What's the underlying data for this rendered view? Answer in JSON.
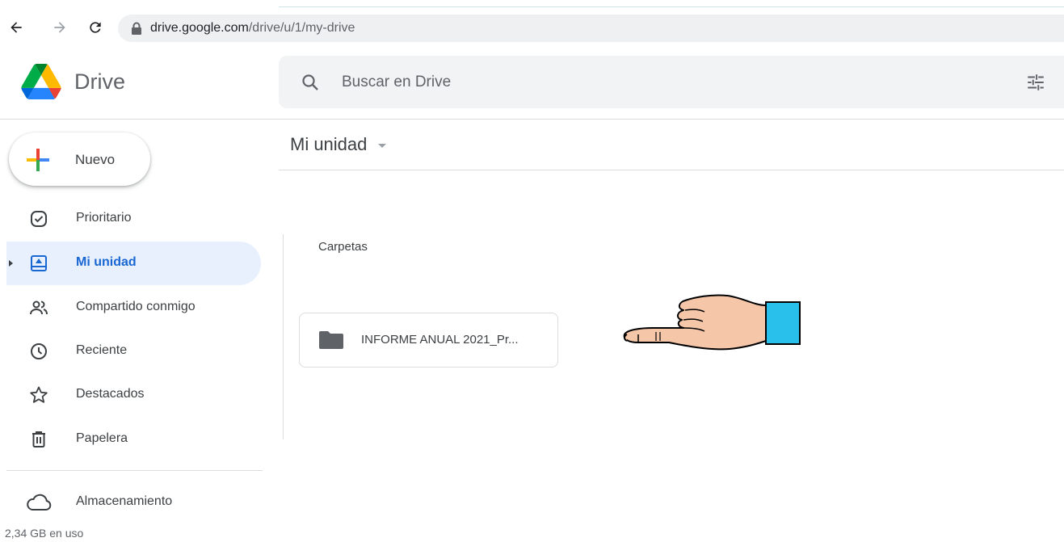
{
  "browser": {
    "url_host": "drive.google.com",
    "url_path": "/drive/u/1/my-drive",
    "icons": [
      "back-arrow-icon",
      "forward-arrow-icon",
      "reload-icon",
      "lock-icon"
    ]
  },
  "header": {
    "brand": "Drive",
    "search_placeholder": "Buscar en Drive"
  },
  "sidebar": {
    "new_label": "Nuevo",
    "items": [
      {
        "label": "Prioritario",
        "icon": "priority-check-icon"
      },
      {
        "label": "Mi unidad",
        "icon": "my-drive-icon",
        "active": true
      },
      {
        "label": "Compartido conmigo",
        "icon": "shared-people-icon"
      },
      {
        "label": "Reciente",
        "icon": "clock-icon"
      },
      {
        "label": "Destacados",
        "icon": "star-icon"
      },
      {
        "label": "Papelera",
        "icon": "trash-icon"
      }
    ],
    "storage_label": "Almacenamiento",
    "storage_used": "2,34 GB en uso"
  },
  "main": {
    "title": "Mi unidad",
    "section": "Carpetas",
    "folders": [
      {
        "name": "INFORME ANUAL 2021_Pr..."
      }
    ]
  },
  "colors": {
    "accent_blue": "#1967d2",
    "active_bg": "#e8f0fe",
    "search_bg": "#f1f3f4",
    "hand_skin": "#f5c6a8",
    "hand_cuff": "#29c0ec"
  }
}
